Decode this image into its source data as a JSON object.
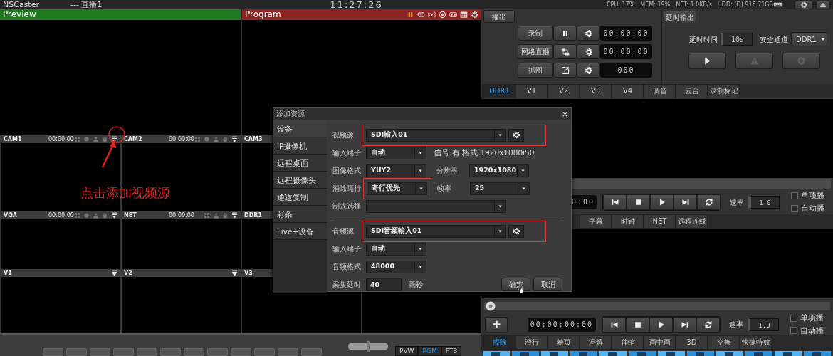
{
  "top_bar": {
    "app_title": "NSCaster",
    "session": "--- 直播1",
    "clock": "11:27:26",
    "stats": [
      "CPU: 17%",
      "MEM: 19%",
      "NET: 1.0KB/s",
      "HDD: (D) 916.71GB"
    ]
  },
  "preview": {
    "title": "Preview"
  },
  "program": {
    "title": "Program"
  },
  "source_rows": [
    [
      {
        "name": "CAM1",
        "time": "00:00:00",
        "kind": "camera"
      },
      {
        "name": "CAM2",
        "time": "00:00:00",
        "kind": "camera"
      },
      {
        "name": "CAM3",
        "kind": "label_only"
      }
    ],
    [
      {
        "name": "VGA",
        "time": "00:00:00",
        "kind": "camera"
      },
      {
        "name": "NET",
        "time": "00:00:00",
        "kind": "net"
      },
      {
        "name": "DDR1",
        "kind": "label_only"
      }
    ],
    [
      {
        "name": "V1",
        "kind": "menu"
      },
      {
        "name": "V2",
        "kind": "menu"
      },
      {
        "name": "V3",
        "kind": "label_only"
      }
    ]
  ],
  "output_buttons": [
    {
      "label": "PVW",
      "selected": false
    },
    {
      "label": "PGM",
      "selected": true
    },
    {
      "label": "FTB",
      "selected": false
    }
  ],
  "output_panel": {
    "tab": "播出",
    "rows": [
      {
        "label": "录制",
        "kind": "record",
        "time": "00:00:00"
      },
      {
        "label": "网络直播",
        "kind": "stream",
        "time": "00:00:00"
      },
      {
        "label": "抓图",
        "kind": "snapshot",
        "time": "000"
      }
    ]
  },
  "delay_panel": {
    "tab": "延时输出",
    "delay_label": "延时时间",
    "delay_value": "10s",
    "safe_label": "安全通道",
    "safe_value": "DDR1",
    "buttons": [
      {
        "kind": "play",
        "disabled": false
      },
      {
        "kind": "warning",
        "disabled": true
      },
      {
        "kind": "shield",
        "disabled": true
      }
    ]
  },
  "channel_tabs": [
    {
      "label": "DDR1",
      "selected": true
    },
    {
      "label": "V1",
      "selected": false
    },
    {
      "label": "V2",
      "selected": false
    },
    {
      "label": "V3",
      "selected": false
    },
    {
      "label": "V4",
      "selected": false
    },
    {
      "label": "调音",
      "selected": false
    },
    {
      "label": "云台",
      "selected": false
    },
    {
      "label": "录制标记",
      "selected": false
    }
  ],
  "player_top": {
    "time": "0:00",
    "rate_label": "速率",
    "rate": "1.0",
    "options": [
      {
        "label": "单项播",
        "checked": false
      },
      {
        "label": "自动播",
        "checked": false
      }
    ]
  },
  "overlay_tabs": [
    {
      "label": "字幕",
      "selected": false
    },
    {
      "label": "时钟",
      "selected": false
    },
    {
      "label": "NET",
      "selected": false
    },
    {
      "label": "远程连线",
      "selected": false
    }
  ],
  "player_bottom": {
    "level": 0,
    "time": "00:00:00:00",
    "rate_label": "速率",
    "rate": "1.0",
    "options": [
      {
        "label": "单项播",
        "checked": false
      },
      {
        "label": "自动播",
        "checked": false
      }
    ]
  },
  "transition_tabs": [
    {
      "label": "擦除",
      "selected": true
    },
    {
      "label": "滑行",
      "selected": false
    },
    {
      "label": "卷页",
      "selected": false
    },
    {
      "label": "溶解",
      "selected": false
    },
    {
      "label": "伸缩",
      "selected": false
    },
    {
      "label": "画中画",
      "selected": false
    },
    {
      "label": "3D",
      "selected": false
    },
    {
      "label": "交换",
      "selected": false
    },
    {
      "label": "快捷特效",
      "selected": false
    }
  ],
  "dialog": {
    "title": "添加资源",
    "categories": [
      {
        "label": "设备",
        "selected": true
      },
      {
        "label": "IP摄像机",
        "selected": false
      },
      {
        "label": "远程桌面",
        "selected": false
      },
      {
        "label": "远程摄像头",
        "selected": false
      },
      {
        "label": "通道复制",
        "selected": false
      },
      {
        "label": "彩条",
        "selected": false
      },
      {
        "label": "Live+设备",
        "selected": false
      }
    ],
    "rows": [
      {
        "kind": "select_gear",
        "label": "视频源",
        "value": "SDI输入01",
        "highlighted": true
      },
      {
        "kind": "select_info",
        "label": "输入端子",
        "value": "自动",
        "info": "信号:有 格式:1920x1080i50"
      },
      {
        "kind": "select_pair",
        "label": "图像格式",
        "value": "YUY2",
        "label2": "分辨率",
        "value2": "1920x1080",
        "highlighted": false
      },
      {
        "kind": "select_pair",
        "label": "消除隔行",
        "value": "奇行优先",
        "label2": "帧率",
        "value2": "25",
        "highlighted": true
      },
      {
        "kind": "select_wide",
        "label": "制式选择"
      },
      {
        "kind": "divider"
      },
      {
        "kind": "select_gear",
        "label": "音频源",
        "value": "SDI音频输入01",
        "highlighted": true
      },
      {
        "kind": "select",
        "label": "输入端子",
        "value": "自动"
      },
      {
        "kind": "select",
        "label": "音频格式",
        "value": "48000"
      },
      {
        "kind": "number",
        "label": "采集延时",
        "value": "40",
        "unit": "毫秒"
      }
    ],
    "buttons": [
      {
        "label": "确定",
        "kind": "ok"
      },
      {
        "label": "取消",
        "kind": "cancel"
      }
    ]
  },
  "annotation": {
    "text": "点击添加视频源"
  }
}
